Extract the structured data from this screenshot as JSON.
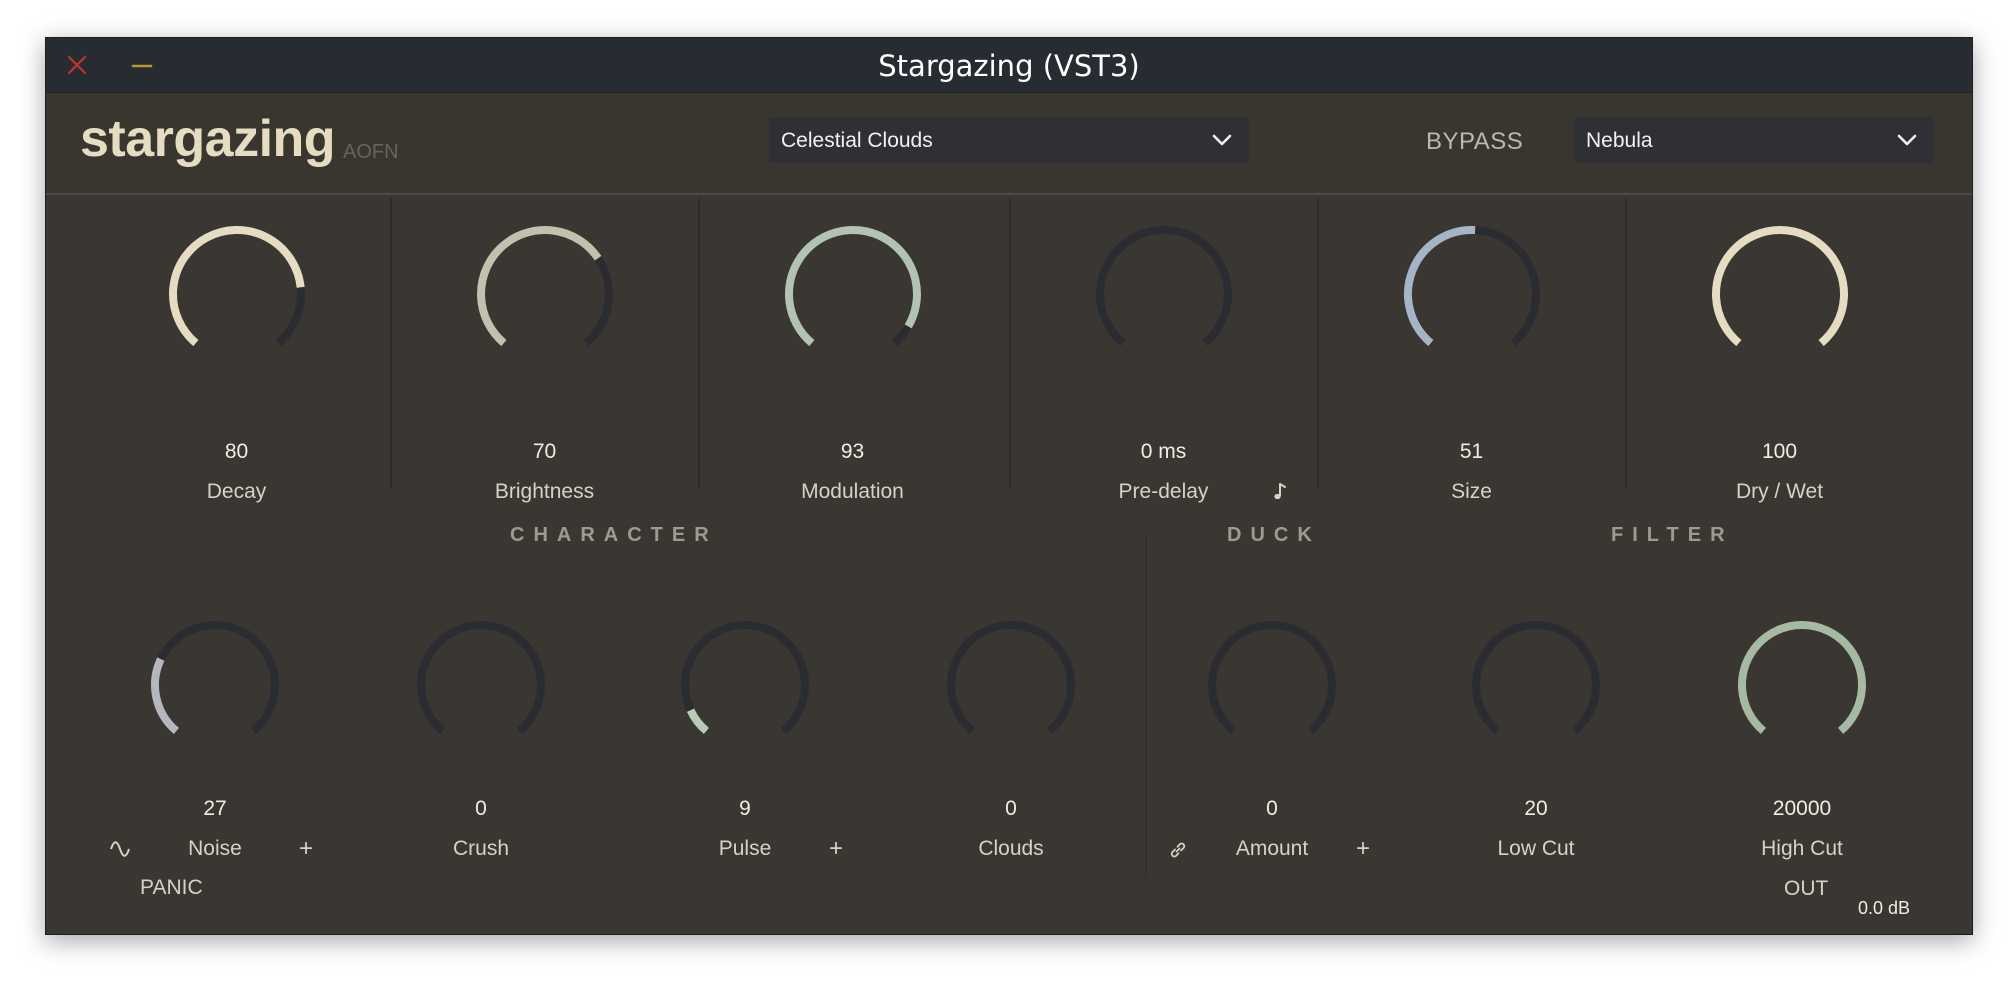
{
  "window": {
    "title": "Stargazing (VST3)",
    "close_icon": "close-icon",
    "minimize_icon": "minimize-icon"
  },
  "header": {
    "logo": "stargazing",
    "maker": "AOFN",
    "preset": {
      "value": "Celestial Clouds",
      "icon": "chevron-down-icon"
    },
    "bypass_label": "BYPASS",
    "mode": {
      "value": "Nebula",
      "icon": "chevron-down-icon"
    }
  },
  "main_knobs": [
    {
      "id": "decay",
      "value": "80",
      "label": "Decay",
      "level": 0.8,
      "color": "#e6dcc1"
    },
    {
      "id": "brightness",
      "value": "70",
      "label": "Brightness",
      "level": 0.7,
      "color": "#c4c0ae"
    },
    {
      "id": "modulation",
      "value": "93",
      "label": "Modulation",
      "level": 0.93,
      "color": "#b2c3b3"
    },
    {
      "id": "pre-delay",
      "value": "0 ms",
      "label": "Pre-delay",
      "level": 0.0,
      "color": "#c7c0a8",
      "icon": "music-note-icon"
    },
    {
      "id": "size",
      "value": "51",
      "label": "Size",
      "level": 0.51,
      "color": "#a5b4c6"
    },
    {
      "id": "dry-wet",
      "value": "100",
      "label": "Dry / Wet",
      "level": 1.0,
      "color": "#e6dcc1"
    }
  ],
  "sections": {
    "character": "CHARACTER",
    "duck": "DUCK",
    "filter": "FILTER"
  },
  "bottom_knobs": [
    {
      "id": "noise",
      "value": "27",
      "label": "Noise",
      "level": 0.27,
      "color": "#b5b6bf",
      "left_icon": "sine-wave-icon",
      "plus": "+"
    },
    {
      "id": "crush",
      "value": "0",
      "label": "Crush",
      "level": 0.0,
      "color": "#b5b6bf"
    },
    {
      "id": "pulse",
      "value": "9",
      "label": "Pulse",
      "level": 0.09,
      "color": "#b9cbb6",
      "plus": "+"
    },
    {
      "id": "clouds",
      "value": "0",
      "label": "Clouds",
      "level": 0.0,
      "color": "#b5b6bf"
    },
    {
      "id": "amount",
      "value": "0",
      "label": "Amount",
      "level": 0.0,
      "color": "#b5b6bf",
      "left_icon": "link-icon",
      "plus": "+"
    },
    {
      "id": "low-cut",
      "value": "20",
      "label": "Low Cut",
      "level": 0.0,
      "color": "#b5b6bf"
    },
    {
      "id": "high-cut",
      "value": "20000",
      "label": "High Cut",
      "level": 1.0,
      "color": "#a6b9a2"
    }
  ],
  "footer": {
    "panic": "PANIC",
    "out_label": "OUT",
    "out_value": "0.0 dB"
  },
  "colors": {
    "panel": "#3a3631",
    "titlebar": "#262c32",
    "track": "#2b2c31",
    "close": "#c0352b",
    "minimize": "#b89a2a"
  }
}
